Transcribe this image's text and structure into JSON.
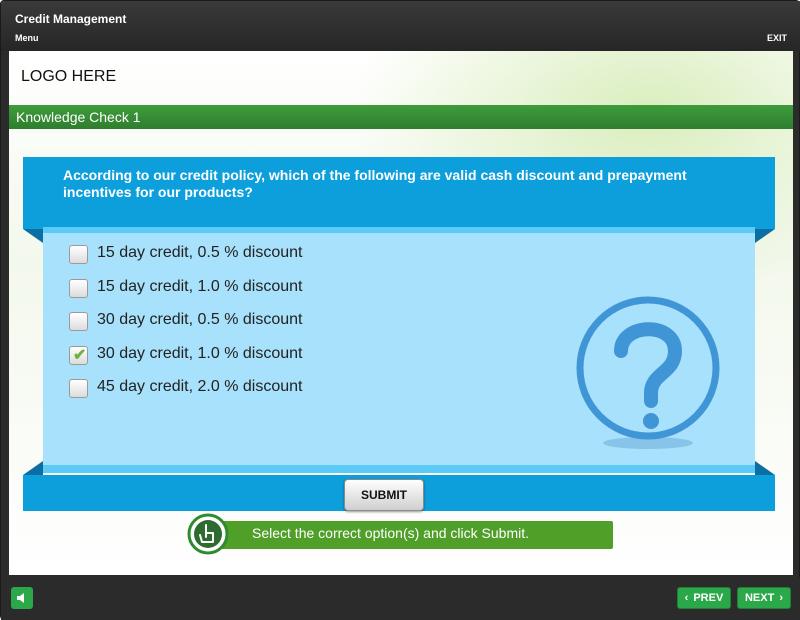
{
  "header": {
    "title": "Credit Management",
    "menu_label": "Menu",
    "exit_label": "EXIT"
  },
  "logo_text": "LOGO HERE",
  "section_title": "Knowledge Check 1",
  "question": "According to our credit policy, which of the following are valid cash discount and prepayment incentives for our products?",
  "options": [
    {
      "label": "15 day credit, 0.5 % discount",
      "checked": false
    },
    {
      "label": "15 day credit, 1.0 % discount",
      "checked": false
    },
    {
      "label": "30 day credit, 0.5 % discount",
      "checked": false
    },
    {
      "label": "30 day credit, 1.0 % discount",
      "checked": true
    },
    {
      "label": "45 day credit, 2.0 % discount",
      "checked": false
    }
  ],
  "submit_label": "SUBMIT",
  "hint_text": "Select the correct option(s) and click Submit.",
  "footer": {
    "prev_label": "PREV",
    "next_label": "NEXT"
  },
  "colors": {
    "accent_blue": "#0d9fdc",
    "panel_blue": "#a8e1fb",
    "accent_green": "#2ba84a",
    "hint_green": "#4f9f29"
  }
}
